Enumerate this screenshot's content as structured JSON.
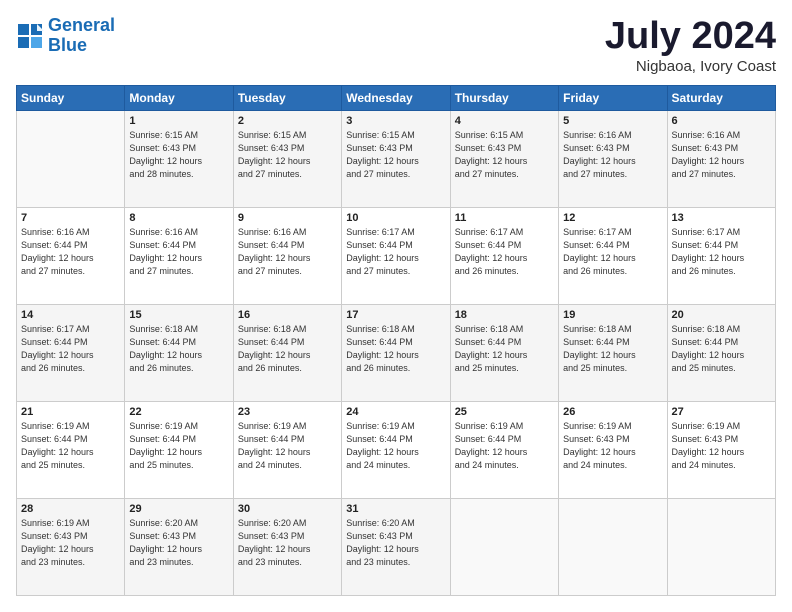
{
  "logo": {
    "line1": "General",
    "line2": "Blue"
  },
  "title": "July 2024",
  "location": "Nigbaoa, Ivory Coast",
  "days_of_week": [
    "Sunday",
    "Monday",
    "Tuesday",
    "Wednesday",
    "Thursday",
    "Friday",
    "Saturday"
  ],
  "weeks": [
    [
      {
        "day": "",
        "info": ""
      },
      {
        "day": "1",
        "info": "Sunrise: 6:15 AM\nSunset: 6:43 PM\nDaylight: 12 hours\nand 28 minutes."
      },
      {
        "day": "2",
        "info": "Sunrise: 6:15 AM\nSunset: 6:43 PM\nDaylight: 12 hours\nand 27 minutes."
      },
      {
        "day": "3",
        "info": "Sunrise: 6:15 AM\nSunset: 6:43 PM\nDaylight: 12 hours\nand 27 minutes."
      },
      {
        "day": "4",
        "info": "Sunrise: 6:15 AM\nSunset: 6:43 PM\nDaylight: 12 hours\nand 27 minutes."
      },
      {
        "day": "5",
        "info": "Sunrise: 6:16 AM\nSunset: 6:43 PM\nDaylight: 12 hours\nand 27 minutes."
      },
      {
        "day": "6",
        "info": "Sunrise: 6:16 AM\nSunset: 6:43 PM\nDaylight: 12 hours\nand 27 minutes."
      }
    ],
    [
      {
        "day": "7",
        "info": "Sunrise: 6:16 AM\nSunset: 6:44 PM\nDaylight: 12 hours\nand 27 minutes."
      },
      {
        "day": "8",
        "info": "Sunrise: 6:16 AM\nSunset: 6:44 PM\nDaylight: 12 hours\nand 27 minutes."
      },
      {
        "day": "9",
        "info": "Sunrise: 6:16 AM\nSunset: 6:44 PM\nDaylight: 12 hours\nand 27 minutes."
      },
      {
        "day": "10",
        "info": "Sunrise: 6:17 AM\nSunset: 6:44 PM\nDaylight: 12 hours\nand 27 minutes."
      },
      {
        "day": "11",
        "info": "Sunrise: 6:17 AM\nSunset: 6:44 PM\nDaylight: 12 hours\nand 26 minutes."
      },
      {
        "day": "12",
        "info": "Sunrise: 6:17 AM\nSunset: 6:44 PM\nDaylight: 12 hours\nand 26 minutes."
      },
      {
        "day": "13",
        "info": "Sunrise: 6:17 AM\nSunset: 6:44 PM\nDaylight: 12 hours\nand 26 minutes."
      }
    ],
    [
      {
        "day": "14",
        "info": "Sunrise: 6:17 AM\nSunset: 6:44 PM\nDaylight: 12 hours\nand 26 minutes."
      },
      {
        "day": "15",
        "info": "Sunrise: 6:18 AM\nSunset: 6:44 PM\nDaylight: 12 hours\nand 26 minutes."
      },
      {
        "day": "16",
        "info": "Sunrise: 6:18 AM\nSunset: 6:44 PM\nDaylight: 12 hours\nand 26 minutes."
      },
      {
        "day": "17",
        "info": "Sunrise: 6:18 AM\nSunset: 6:44 PM\nDaylight: 12 hours\nand 26 minutes."
      },
      {
        "day": "18",
        "info": "Sunrise: 6:18 AM\nSunset: 6:44 PM\nDaylight: 12 hours\nand 25 minutes."
      },
      {
        "day": "19",
        "info": "Sunrise: 6:18 AM\nSunset: 6:44 PM\nDaylight: 12 hours\nand 25 minutes."
      },
      {
        "day": "20",
        "info": "Sunrise: 6:18 AM\nSunset: 6:44 PM\nDaylight: 12 hours\nand 25 minutes."
      }
    ],
    [
      {
        "day": "21",
        "info": "Sunrise: 6:19 AM\nSunset: 6:44 PM\nDaylight: 12 hours\nand 25 minutes."
      },
      {
        "day": "22",
        "info": "Sunrise: 6:19 AM\nSunset: 6:44 PM\nDaylight: 12 hours\nand 25 minutes."
      },
      {
        "day": "23",
        "info": "Sunrise: 6:19 AM\nSunset: 6:44 PM\nDaylight: 12 hours\nand 24 minutes."
      },
      {
        "day": "24",
        "info": "Sunrise: 6:19 AM\nSunset: 6:44 PM\nDaylight: 12 hours\nand 24 minutes."
      },
      {
        "day": "25",
        "info": "Sunrise: 6:19 AM\nSunset: 6:44 PM\nDaylight: 12 hours\nand 24 minutes."
      },
      {
        "day": "26",
        "info": "Sunrise: 6:19 AM\nSunset: 6:43 PM\nDaylight: 12 hours\nand 24 minutes."
      },
      {
        "day": "27",
        "info": "Sunrise: 6:19 AM\nSunset: 6:43 PM\nDaylight: 12 hours\nand 24 minutes."
      }
    ],
    [
      {
        "day": "28",
        "info": "Sunrise: 6:19 AM\nSunset: 6:43 PM\nDaylight: 12 hours\nand 23 minutes."
      },
      {
        "day": "29",
        "info": "Sunrise: 6:20 AM\nSunset: 6:43 PM\nDaylight: 12 hours\nand 23 minutes."
      },
      {
        "day": "30",
        "info": "Sunrise: 6:20 AM\nSunset: 6:43 PM\nDaylight: 12 hours\nand 23 minutes."
      },
      {
        "day": "31",
        "info": "Sunrise: 6:20 AM\nSunset: 6:43 PM\nDaylight: 12 hours\nand 23 minutes."
      },
      {
        "day": "",
        "info": ""
      },
      {
        "day": "",
        "info": ""
      },
      {
        "day": "",
        "info": ""
      }
    ]
  ]
}
